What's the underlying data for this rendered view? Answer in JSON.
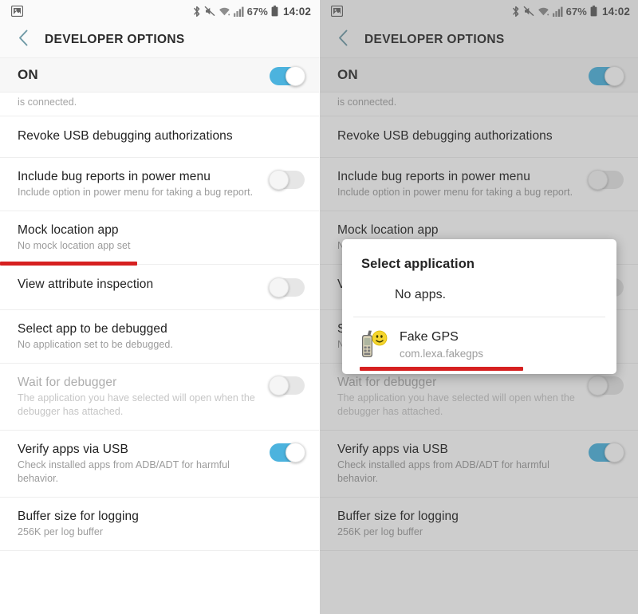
{
  "status_bar": {
    "left_icons": [
      "screenshot-icon"
    ],
    "right_icons": [
      "bluetooth-icon",
      "vibrate-mute-icon",
      "wifi-icon",
      "signal-icon"
    ],
    "battery_percent": "67%",
    "battery_icon": "battery-icon",
    "clock": "14:02"
  },
  "app_bar": {
    "back_icon": "back-chevron-icon",
    "title": "DEVELOPER OPTIONS"
  },
  "master_switch": {
    "label": "ON",
    "state": "on"
  },
  "colors": {
    "toggle_on": "#4cb3de",
    "toggle_off": "#dcdcdc",
    "annotation_red": "#d62020",
    "accent_back_arrow": "#6f9aa6"
  },
  "list": {
    "clipped_row_text": "is connected.",
    "rows": [
      {
        "title": "Revoke USB debugging authorizations",
        "subtitle": "",
        "toggle": "none",
        "disabled": false
      },
      {
        "title": "Include bug reports in power menu",
        "subtitle": "Include option in power menu for taking a bug report.",
        "toggle": "off",
        "disabled": false
      },
      {
        "title": "Mock location app",
        "subtitle": "No mock location app set",
        "toggle": "none",
        "disabled": false
      },
      {
        "title": "View attribute inspection",
        "subtitle": "",
        "toggle": "off",
        "disabled": false
      },
      {
        "title": "Select app to be debugged",
        "subtitle": "No application set to be debugged.",
        "toggle": "none",
        "disabled": false
      },
      {
        "title": "Wait for debugger",
        "subtitle": "The application you have selected will open when the debugger has attached.",
        "toggle": "off",
        "disabled": true
      },
      {
        "title": "Verify apps via USB",
        "subtitle": "Check installed apps from ADB/ADT for harmful behavior.",
        "toggle": "on",
        "disabled": false
      },
      {
        "title": "Buffer size for logging",
        "subtitle": "256K per log buffer",
        "toggle": "none",
        "disabled": false
      }
    ]
  },
  "dialog": {
    "title": "Select application",
    "no_apps_option": "No apps.",
    "app": {
      "icon": "fake-gps-app-icon",
      "name": "Fake GPS",
      "package": "com.lexa.fakegps"
    }
  },
  "annotations": {
    "left_underline_target": "No mock location app set",
    "right_underline_target": "com.lexa.fakegps"
  }
}
